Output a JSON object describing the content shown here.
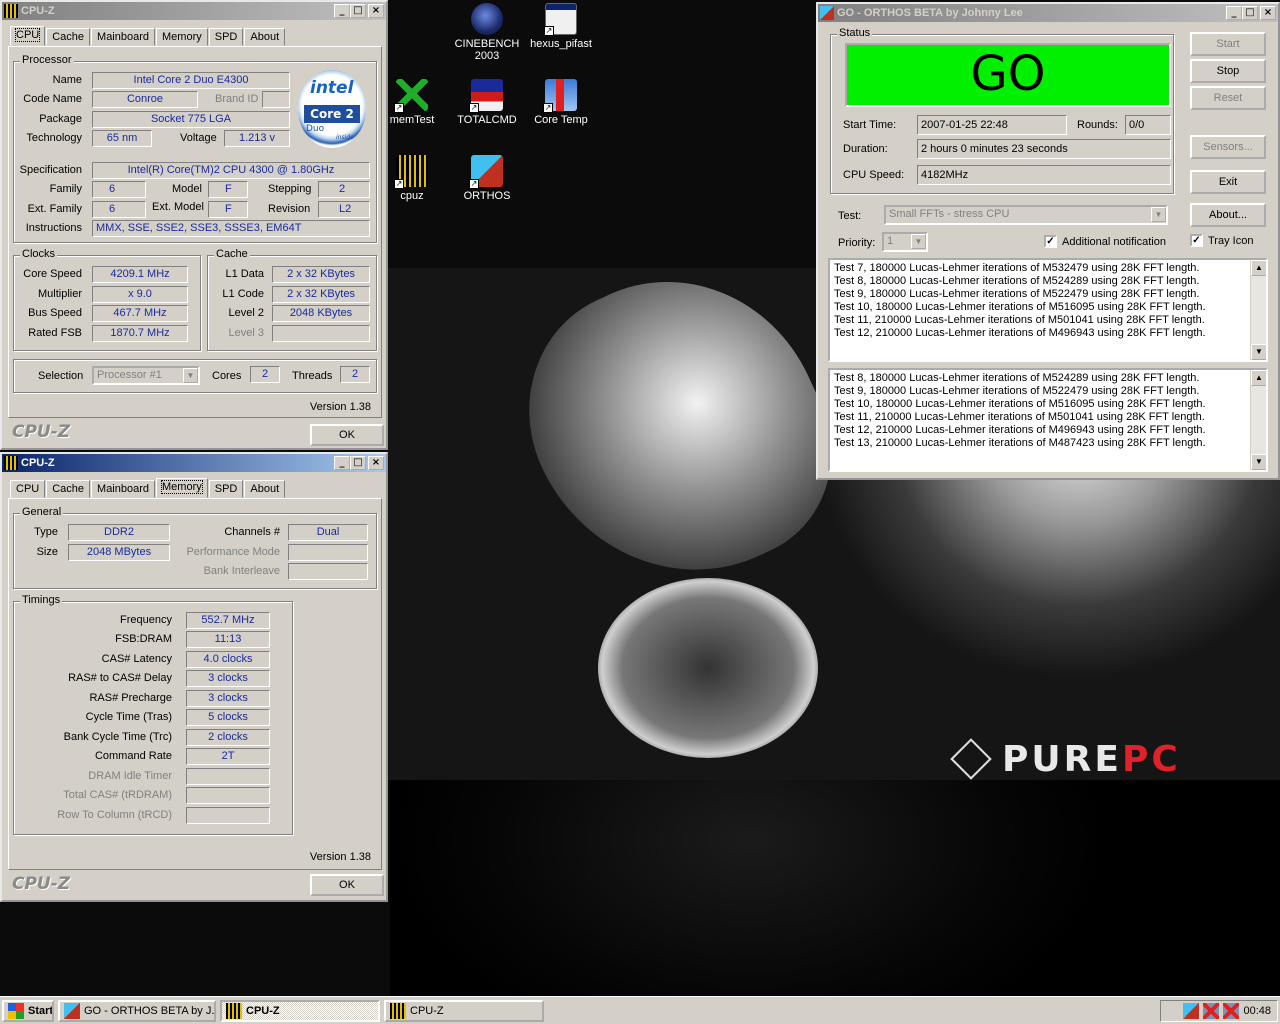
{
  "desktop": {
    "icons": [
      {
        "id": "cinebench",
        "label_line1": "CINEBENCH",
        "label_line2": "2003"
      },
      {
        "id": "hexus",
        "label_line1": "hexus_pifast",
        "label_line2": ""
      },
      {
        "id": "memtest",
        "label_line1": "memTest",
        "label_line2": ""
      },
      {
        "id": "totalcmd",
        "label_line1": "TOTALCMD",
        "label_line2": ""
      },
      {
        "id": "coretemp",
        "label_line1": "Core Temp",
        "label_line2": ""
      },
      {
        "id": "cpuz",
        "label_line1": "cpuz",
        "label_line2": ""
      },
      {
        "id": "orthos",
        "label_line1": "ORTHOS",
        "label_line2": ""
      }
    ],
    "logo": {
      "part1": "PURE",
      "part2": "PC"
    }
  },
  "cpuz_top": {
    "title": "CPU-Z",
    "tabs": [
      "CPU",
      "Cache",
      "Mainboard",
      "Memory",
      "SPD",
      "About"
    ],
    "selected_tab": "CPU",
    "processor": {
      "group_label": "Processor",
      "name_label": "Name",
      "name": "Intel Core 2 Duo E4300",
      "codename_label": "Code Name",
      "codename": "Conroe",
      "brandid_label": "Brand ID",
      "brandid": "",
      "package_label": "Package",
      "package": "Socket 775 LGA",
      "technology_label": "Technology",
      "technology": "65 nm",
      "voltage_label": "Voltage",
      "voltage": "1.213 v",
      "spec_label": "Specification",
      "spec": "Intel(R) Core(TM)2 CPU          4300  @ 1.80GHz",
      "family_label": "Family",
      "family": "6",
      "model_label": "Model",
      "model": "F",
      "stepping_label": "Stepping",
      "stepping": "2",
      "extfamily_label": "Ext. Family",
      "extfamily": "6",
      "extmodel_label": "Ext. Model",
      "extmodel": "F",
      "revision_label": "Revision",
      "revision": "L2",
      "instructions_label": "Instructions",
      "instructions": "MMX, SSE, SSE2, SSE3, SSSE3, EM64T",
      "logo": {
        "brand": "intel",
        "line1": "Core 2",
        "line2": "Duo",
        "tag": "inside"
      }
    },
    "clocks": {
      "group_label": "Clocks",
      "corespeed_label": "Core Speed",
      "corespeed": "4209.1 MHz",
      "multiplier_label": "Multiplier",
      "multiplier": "x 9.0",
      "busspeed_label": "Bus Speed",
      "busspeed": "467.7 MHz",
      "ratedfsb_label": "Rated FSB",
      "ratedfsb": "1870.7 MHz"
    },
    "cache": {
      "group_label": "Cache",
      "l1data_label": "L1 Data",
      "l1data": "2 x 32 KBytes",
      "l1code_label": "L1 Code",
      "l1code": "2 x 32 KBytes",
      "level2_label": "Level 2",
      "level2": "2048 KBytes",
      "level3_label": "Level 3",
      "level3": ""
    },
    "selection_label": "Selection",
    "selection": "Processor #1",
    "cores_label": "Cores",
    "cores": "2",
    "threads_label": "Threads",
    "threads": "2",
    "version": "Version 1.38",
    "brand": "CPU-Z",
    "ok_label": "OK"
  },
  "cpuz_bottom": {
    "title": "CPU-Z",
    "tabs": [
      "CPU",
      "Cache",
      "Mainboard",
      "Memory",
      "SPD",
      "About"
    ],
    "selected_tab": "Memory",
    "general": {
      "group_label": "General",
      "type_label": "Type",
      "type": "DDR2",
      "size_label": "Size",
      "size": "2048 MBytes",
      "channels_label": "Channels #",
      "channels": "Dual",
      "perfmode_label": "Performance Mode",
      "perfmode": "",
      "bankinterleave_label": "Bank Interleave",
      "bankinterleave": ""
    },
    "timings": {
      "group_label": "Timings",
      "rows": [
        {
          "label": "Frequency",
          "value": "552.7 MHz",
          "disabled": false
        },
        {
          "label": "FSB:DRAM",
          "value": "11:13",
          "disabled": false
        },
        {
          "label": "CAS# Latency",
          "value": "4.0 clocks",
          "disabled": false
        },
        {
          "label": "RAS# to CAS# Delay",
          "value": "3 clocks",
          "disabled": false
        },
        {
          "label": "RAS# Precharge",
          "value": "3 clocks",
          "disabled": false
        },
        {
          "label": "Cycle Time (Tras)",
          "value": "5 clocks",
          "disabled": false
        },
        {
          "label": "Bank Cycle Time (Trc)",
          "value": "2 clocks",
          "disabled": false
        },
        {
          "label": "Command Rate",
          "value": "2T",
          "disabled": false
        },
        {
          "label": "DRAM Idle Timer",
          "value": "",
          "disabled": true
        },
        {
          "label": "Total CAS# (tRDRAM)",
          "value": "",
          "disabled": true
        },
        {
          "label": "Row To Column (tRCD)",
          "value": "",
          "disabled": true
        }
      ]
    },
    "version": "Version 1.38",
    "brand": "CPU-Z",
    "ok_label": "OK"
  },
  "orthos": {
    "title": "GO - ORTHOS BETA by Johnny Lee",
    "status_label": "Status",
    "status": "GO",
    "status_color": "#00f000",
    "start_time_label": "Start Time:",
    "start_time": "2007-01-25 22:48",
    "rounds_label": "Rounds:",
    "rounds": "0/0",
    "duration_label": "Duration:",
    "duration": "2 hours 0 minutes 23 seconds",
    "cpu_speed_label": "CPU Speed:",
    "cpu_speed": "4182MHz",
    "test_label": "Test:",
    "test": "Small FFTs - stress CPU",
    "priority_label": "Priority:",
    "priority": "1",
    "additional_notification_label": "Additional notification",
    "additional_notification": true,
    "tray_icon_label": "Tray Icon",
    "tray_icon": true,
    "buttons": {
      "start": "Start",
      "stop": "Stop",
      "reset": "Reset",
      "sensors": "Sensors...",
      "exit": "Exit",
      "about": "About..."
    },
    "log1": [
      "Test 7, 180000 Lucas-Lehmer iterations of M532479 using 28K FFT length.",
      "Test 8, 180000 Lucas-Lehmer iterations of M524289 using 28K FFT length.",
      "Test 9, 180000 Lucas-Lehmer iterations of M522479 using 28K FFT length.",
      "Test 10, 180000 Lucas-Lehmer iterations of M516095 using 28K FFT length.",
      "Test 11, 210000 Lucas-Lehmer iterations of M501041 using 28K FFT length.",
      "Test 12, 210000 Lucas-Lehmer iterations of M496943 using 28K FFT length."
    ],
    "log2": [
      "Test 8, 180000 Lucas-Lehmer iterations of M524289 using 28K FFT length.",
      "Test 9, 180000 Lucas-Lehmer iterations of M522479 using 28K FFT length.",
      "Test 10, 180000 Lucas-Lehmer iterations of M516095 using 28K FFT length.",
      "Test 11, 210000 Lucas-Lehmer iterations of M501041 using 28K FFT length.",
      "Test 12, 210000 Lucas-Lehmer iterations of M496943 using 28K FFT length.",
      "Test 13, 210000 Lucas-Lehmer iterations of M487423 using 28K FFT length."
    ]
  },
  "taskbar": {
    "start_label": "Start",
    "tasks": [
      "GO - ORTHOS BETA by J...",
      "CPU-Z",
      "CPU-Z"
    ],
    "clock": "00:48"
  }
}
